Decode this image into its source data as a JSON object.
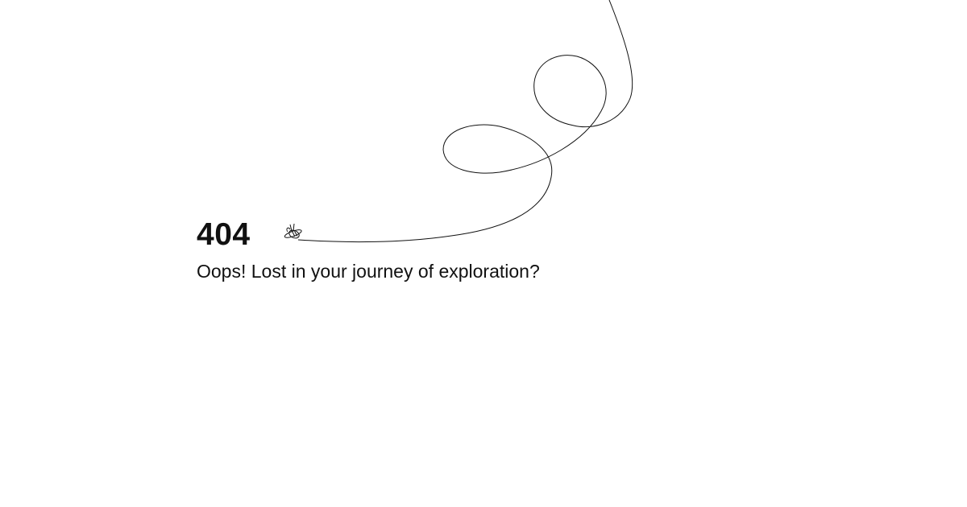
{
  "error": {
    "code": "404",
    "message": "Oops! Lost in your journey of exploration?"
  },
  "illustration": {
    "icon": "bee-icon",
    "path": "dashed-flight-path",
    "stroke_color": "#111111"
  },
  "colors": {
    "background": "#ffffff",
    "text": "#111111"
  }
}
